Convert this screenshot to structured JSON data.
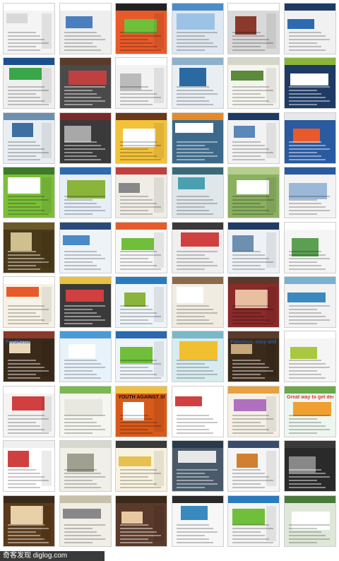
{
  "caption": "奇客发现 diglog.com",
  "thumb_labels": {
    "feedburner": "FeedRinse",
    "sudoku": "YOUTH AGAINST SUDOKU",
    "slogan": "Fabulous, easy and good for you",
    "cta": "Great way to get deo online."
  },
  "thumbnails": [
    {
      "bg": "#f4f4f4",
      "bar": "#ffffff",
      "accent": "#d9d9d9"
    },
    {
      "bg": "#eeeeee",
      "bar": "#ffffff",
      "accent": "#4a7fbf"
    },
    {
      "bg": "#e85a2a",
      "bar": "#222222",
      "accent": "#6fbf3a"
    },
    {
      "bg": "#dfe8f0",
      "bar": "#4c8cc7",
      "accent": "#9ac3e6"
    },
    {
      "bg": "#d9d9d9",
      "bar": "#ffffff",
      "accent": "#8a3a2a"
    },
    {
      "bg": "#f1f1f1",
      "bar": "#1f3b63",
      "accent": "#2c6bb0"
    },
    {
      "bg": "#f0f0f0",
      "bar": "#1c4f8f",
      "accent": "#3aa64a"
    },
    {
      "bg": "#4a4a4a",
      "bar": "#5a3a2a",
      "accent": "#c04040"
    },
    {
      "bg": "#f2f2f2",
      "bar": "#ffffff",
      "accent": "#bbbbbb"
    },
    {
      "bg": "#e8eef2",
      "bar": "#8fb0c8",
      "accent": "#2a6aa3"
    },
    {
      "bg": "#f5f5f0",
      "bar": "#d6d6c8",
      "accent": "#5a8a3a"
    },
    {
      "bg": "#1f3b63",
      "bar": "#8ab43a",
      "accent": "#ffffff"
    },
    {
      "bg": "#e9eef3",
      "bar": "#6d8fb0",
      "accent": "#3d6fa0"
    },
    {
      "bg": "#3a3a3a",
      "bar": "#7a2a2a",
      "accent": "#a8a8a8"
    },
    {
      "bg": "#f3c23a",
      "bar": "#6a3a1a",
      "accent": "#ffffff"
    },
    {
      "bg": "#3d6a8a",
      "bar": "#e58a2a",
      "accent": "#ffffff"
    },
    {
      "bg": "#f2f2f2",
      "bar": "#1f3b63",
      "accent": "#5a88b8"
    },
    {
      "bg": "#2a5aa0",
      "bar": "#e8e8e8",
      "accent": "#e85a2a"
    },
    {
      "bg": "#7bbf3a",
      "bar": "#3d7a2a",
      "accent": "#ffffff"
    },
    {
      "bg": "#e6eef6",
      "bar": "#2c6bb0",
      "accent": "#8ab43a"
    },
    {
      "bg": "#f0ede6",
      "bar": "#c04040",
      "accent": "#888888"
    },
    {
      "bg": "#dfe7ea",
      "bar": "#3a6a7a",
      "accent": "#4aa0b0"
    },
    {
      "bg": "#8ab060",
      "bar": "#b5cf8a",
      "accent": "#ffffff"
    },
    {
      "bg": "#f3f3f3",
      "bar": "#2a5aa0",
      "accent": "#9bb8d8"
    },
    {
      "bg": "#4a3a1a",
      "bar": "#6a5a2a",
      "accent": "#d0c090"
    },
    {
      "bg": "#eef3f7",
      "bar": "#2a4a7a",
      "accent": "#4a8ac8"
    },
    {
      "bg": "#f7f7f7",
      "bar": "#e85a2a",
      "accent": "#6fbf3a"
    },
    {
      "bg": "#efefef",
      "bar": "#3a3a3a",
      "accent": "#d04040"
    },
    {
      "bg": "#eef2f6",
      "bar": "#1f3b63",
      "accent": "#6d8fb0"
    },
    {
      "bg": "#f5f5f5",
      "bar": "#ffffff",
      "accent": "#5aa050"
    },
    {
      "bg": "#f7f2e6",
      "bar": "#ffffff",
      "accent": "#e85a2a"
    },
    {
      "bg": "#3a3a3a",
      "bar": "#e8c040",
      "accent": "#d04040"
    },
    {
      "bg": "#eef4f8",
      "bar": "#2a7ac0",
      "accent": "#8ab43a"
    },
    {
      "bg": "#f0ece2",
      "bar": "#8a6a4a",
      "accent": "#ffffff"
    },
    {
      "bg": "#8a2a2a",
      "bar": "#5a3a2a",
      "accent": "#e8c0a0"
    },
    {
      "bg": "#f2f2f2",
      "bar": "#7ab0d0",
      "accent": "#3a8ac0"
    },
    {
      "bg": "#3a2a1a",
      "bar": "#8a3a2a",
      "accent": "#e8d8b8"
    },
    {
      "bg": "#e8f2fa",
      "bar": "#4a9ad8",
      "accent": "#ffffff"
    },
    {
      "bg": "#eef4fa",
      "bar": "#2a6ab0",
      "accent": "#6fbf3a"
    },
    {
      "bg": "#d8ecf0",
      "bar": "#7ab8c8",
      "accent": "#f0c030"
    },
    {
      "bg": "#3a2a1a",
      "bar": "#5a3a2a",
      "accent": "#c8a878"
    },
    {
      "bg": "#f5f5f5",
      "bar": "#ffffff",
      "accent": "#a8c840"
    },
    {
      "bg": "#f4f4f4",
      "bar": "#ffffff",
      "accent": "#d04040"
    },
    {
      "bg": "#f6f6f0",
      "bar": "#7ab850",
      "accent": "#e8e8e0"
    },
    {
      "bg": "#d85a1a",
      "bar": "#f0c040",
      "accent": "#ffffff"
    },
    {
      "bg": "#ffffff",
      "bar": "#ffffff",
      "accent": "#d04040"
    },
    {
      "bg": "#f5f0e6",
      "bar": "#e8a040",
      "accent": "#b070c0"
    },
    {
      "bg": "#eef6f0",
      "bar": "#6aa84a",
      "accent": "#f0a030"
    },
    {
      "bg": "#ffffff",
      "bar": "#f0f0f0",
      "accent": "#d04040"
    },
    {
      "bg": "#f0efe8",
      "bar": "#d8d8d0",
      "accent": "#a0a090"
    },
    {
      "bg": "#f8f3e0",
      "bar": "#3a3a3a",
      "accent": "#e8c050"
    },
    {
      "bg": "#4a5a6a",
      "bar": "#2a3a4a",
      "accent": "#e8e8e8"
    },
    {
      "bg": "#f5f5f5",
      "bar": "#3a4a6a",
      "accent": "#d08030"
    },
    {
      "bg": "#2a2a2a",
      "bar": "#3a3a3a",
      "accent": "#888888"
    },
    {
      "bg": "#5a3a1a",
      "bar": "#3a2a1a",
      "accent": "#e8d0a8"
    },
    {
      "bg": "#f0eee6",
      "bar": "#c8c0a8",
      "accent": "#888888"
    },
    {
      "bg": "#5a3a2a",
      "bar": "#3a2a1a",
      "accent": "#e8c8a0"
    },
    {
      "bg": "#f7f7f7",
      "bar": "#2a2a2a",
      "accent": "#3a8ac0"
    },
    {
      "bg": "#f4f4f4",
      "bar": "#2a7ac0",
      "accent": "#6fbf3a"
    },
    {
      "bg": "#dfe8d8",
      "bar": "#4a7a3a",
      "accent": "#ffffff"
    },
    {
      "bg": "#eef4fa",
      "bar": "#6fbf3a",
      "accent": "#2a6ab0"
    }
  ]
}
